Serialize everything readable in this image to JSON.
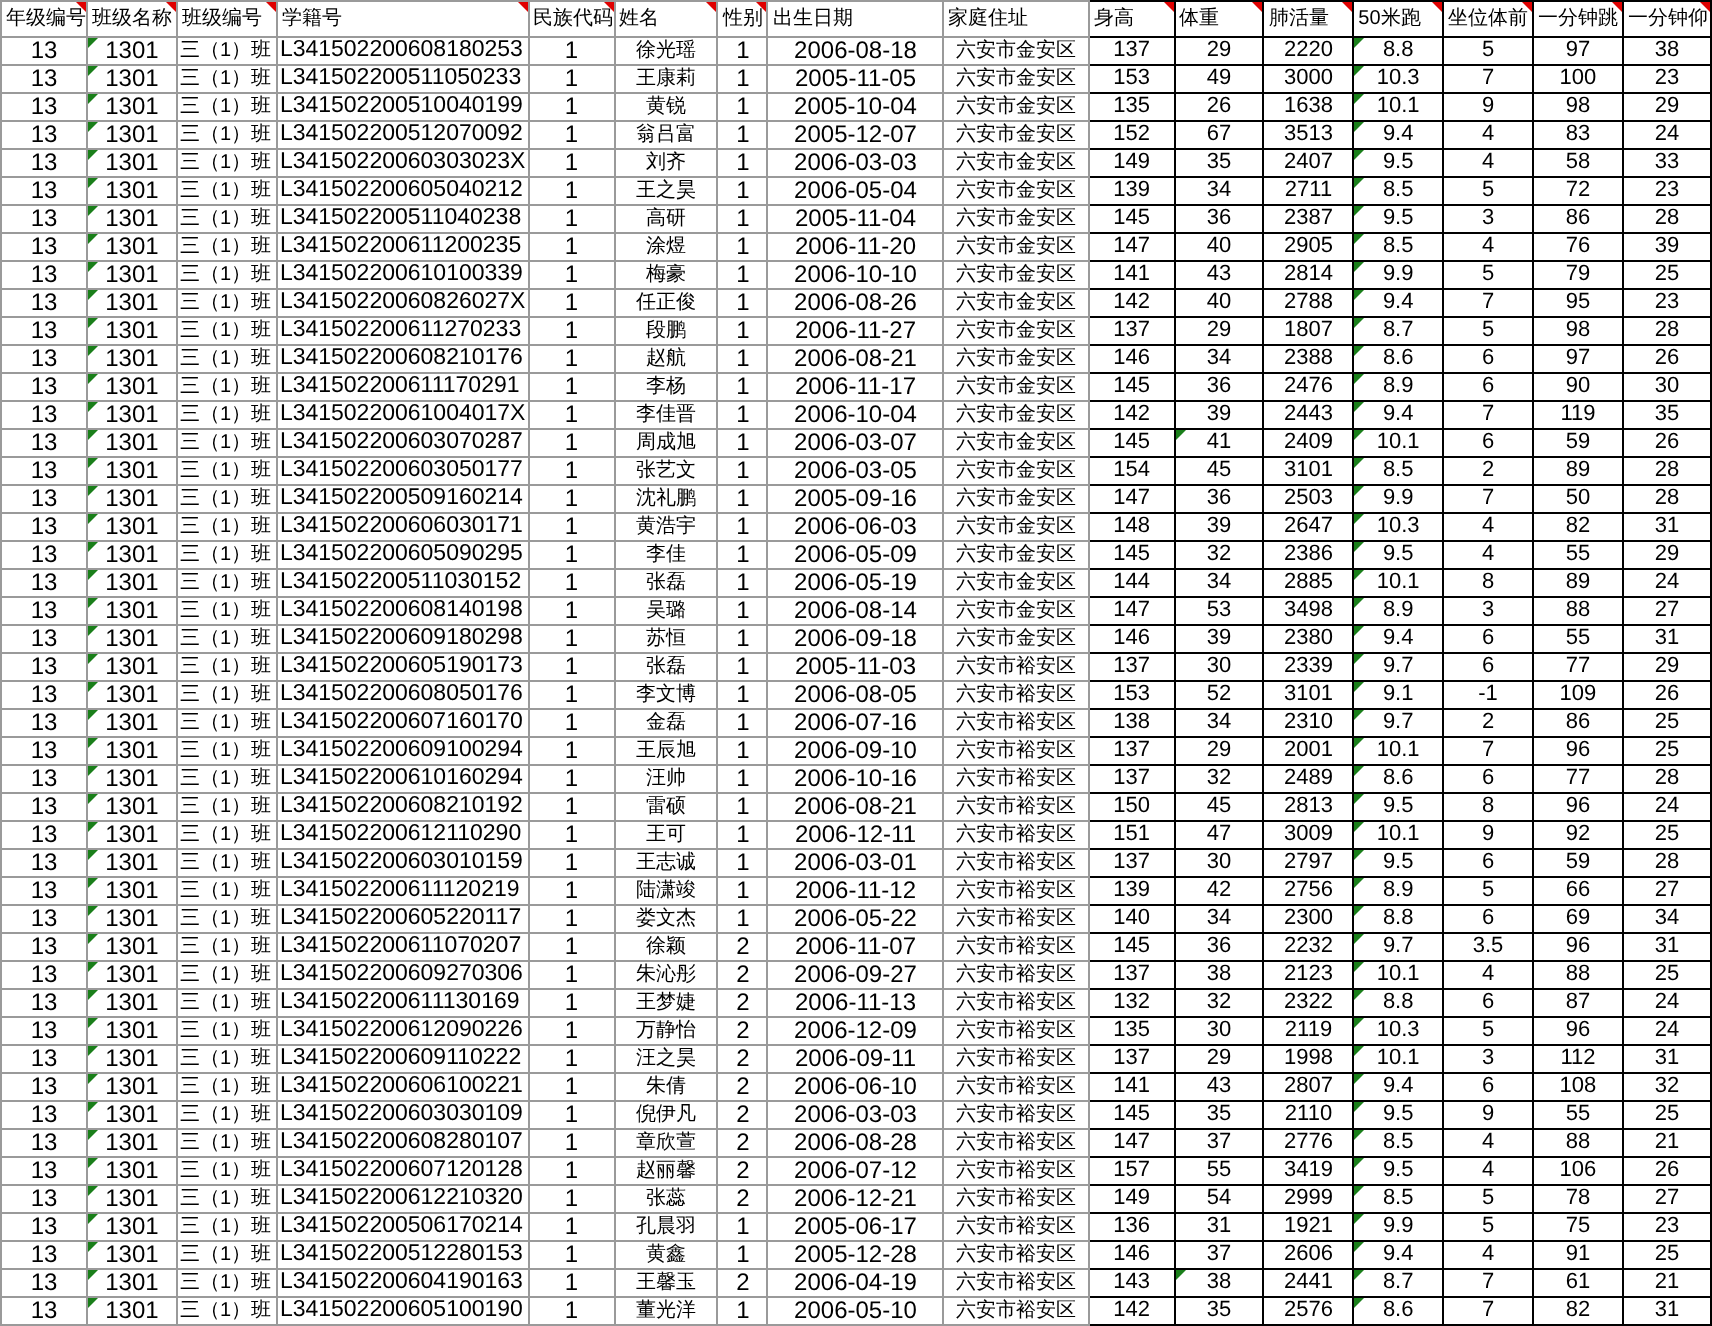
{
  "columns": [
    {
      "label": "年级编号",
      "comment": true,
      "flagged": false
    },
    {
      "label": "班级名称",
      "comment": true,
      "flagged": true
    },
    {
      "label": "班级编号",
      "comment": true,
      "flagged": false
    },
    {
      "label": "学籍号",
      "comment": true,
      "flagged": false
    },
    {
      "label": "民族代码",
      "comment": true,
      "flagged": false
    },
    {
      "label": "姓名",
      "comment": true,
      "flagged": false
    },
    {
      "label": "性别",
      "comment": true,
      "flagged": false
    },
    {
      "label": "出生日期",
      "comment": false,
      "flagged": false
    },
    {
      "label": "家庭住址",
      "comment": false,
      "flagged": false
    },
    {
      "label": "身高",
      "comment": true,
      "flagged": false
    },
    {
      "label": "体重",
      "comment": true,
      "flagged": false
    },
    {
      "label": "肺活量",
      "comment": true,
      "flagged": false
    },
    {
      "label": "50米跑",
      "comment": true,
      "flagged": true
    },
    {
      "label": "坐位体前",
      "comment": true,
      "flagged": false
    },
    {
      "label": "一分钟跳",
      "comment": true,
      "flagged": false
    },
    {
      "label": "一分钟仰",
      "comment": true,
      "flagged": false
    }
  ],
  "rows": [
    {
      "cells": [
        "13",
        "1301",
        "三（1）班",
        "L341502200608180253",
        "1",
        "徐光瑶",
        "1",
        "2006-08-18",
        "六安市金安区",
        "137",
        "29",
        "2220",
        "8.8",
        "5",
        "97",
        "38"
      ],
      "weight_flagged": false
    },
    {
      "cells": [
        "13",
        "1301",
        "三（1）班",
        "L341502200511050233",
        "1",
        "王康莉",
        "1",
        "2005-11-05",
        "六安市金安区",
        "153",
        "49",
        "3000",
        "10.3",
        "7",
        "100",
        "23"
      ],
      "weight_flagged": false
    },
    {
      "cells": [
        "13",
        "1301",
        "三（1）班",
        "L341502200510040199",
        "1",
        "黄锐",
        "1",
        "2005-10-04",
        "六安市金安区",
        "135",
        "26",
        "1638",
        "10.1",
        "9",
        "98",
        "29"
      ],
      "weight_flagged": false
    },
    {
      "cells": [
        "13",
        "1301",
        "三（1）班",
        "L341502200512070092",
        "1",
        "翁吕富",
        "1",
        "2005-12-07",
        "六安市金安区",
        "152",
        "67",
        "3513",
        "9.4",
        "4",
        "83",
        "24"
      ],
      "weight_flagged": false
    },
    {
      "cells": [
        "13",
        "1301",
        "三（1）班",
        "L34150220060303023X",
        "1",
        "刘齐",
        "1",
        "2006-03-03",
        "六安市金安区",
        "149",
        "35",
        "2407",
        "9.5",
        "4",
        "58",
        "33"
      ],
      "weight_flagged": false
    },
    {
      "cells": [
        "13",
        "1301",
        "三（1）班",
        "L341502200605040212",
        "1",
        "王之昊",
        "1",
        "2006-05-04",
        "六安市金安区",
        "139",
        "34",
        "2711",
        "8.5",
        "5",
        "72",
        "23"
      ],
      "weight_flagged": false
    },
    {
      "cells": [
        "13",
        "1301",
        "三（1）班",
        "L341502200511040238",
        "1",
        "高研",
        "1",
        "2005-11-04",
        "六安市金安区",
        "145",
        "36",
        "2387",
        "9.5",
        "3",
        "86",
        "28"
      ],
      "weight_flagged": false
    },
    {
      "cells": [
        "13",
        "1301",
        "三（1）班",
        "L341502200611200235",
        "1",
        "涂煜",
        "1",
        "2006-11-20",
        "六安市金安区",
        "147",
        "40",
        "2905",
        "8.5",
        "4",
        "76",
        "39"
      ],
      "weight_flagged": false
    },
    {
      "cells": [
        "13",
        "1301",
        "三（1）班",
        "L341502200610100339",
        "1",
        "梅豪",
        "1",
        "2006-10-10",
        "六安市金安区",
        "141",
        "43",
        "2814",
        "9.9",
        "5",
        "79",
        "25"
      ],
      "weight_flagged": false
    },
    {
      "cells": [
        "13",
        "1301",
        "三（1）班",
        "L34150220060826027X",
        "1",
        "任正俊",
        "1",
        "2006-08-26",
        "六安市金安区",
        "142",
        "40",
        "2788",
        "9.4",
        "7",
        "95",
        "23"
      ],
      "weight_flagged": false
    },
    {
      "cells": [
        "13",
        "1301",
        "三（1）班",
        "L341502200611270233",
        "1",
        "段鹏",
        "1",
        "2006-11-27",
        "六安市金安区",
        "137",
        "29",
        "1807",
        "8.7",
        "5",
        "98",
        "28"
      ],
      "weight_flagged": false
    },
    {
      "cells": [
        "13",
        "1301",
        "三（1）班",
        "L341502200608210176",
        "1",
        "赵航",
        "1",
        "2006-08-21",
        "六安市金安区",
        "146",
        "34",
        "2388",
        "8.6",
        "6",
        "97",
        "26"
      ],
      "weight_flagged": false
    },
    {
      "cells": [
        "13",
        "1301",
        "三（1）班",
        "L341502200611170291",
        "1",
        "李杨",
        "1",
        "2006-11-17",
        "六安市金安区",
        "145",
        "36",
        "2476",
        "8.9",
        "6",
        "90",
        "30"
      ],
      "weight_flagged": false
    },
    {
      "cells": [
        "13",
        "1301",
        "三（1）班",
        "L34150220061004017X",
        "1",
        "李佳晋",
        "1",
        "2006-10-04",
        "六安市金安区",
        "142",
        "39",
        "2443",
        "9.4",
        "7",
        "119",
        "35"
      ],
      "weight_flagged": false
    },
    {
      "cells": [
        "13",
        "1301",
        "三（1）班",
        "L341502200603070287",
        "1",
        "周成旭",
        "1",
        "2006-03-07",
        "六安市金安区",
        "145",
        "41",
        "2409",
        "10.1",
        "6",
        "59",
        "26"
      ],
      "weight_flagged": true
    },
    {
      "cells": [
        "13",
        "1301",
        "三（1）班",
        "L341502200603050177",
        "1",
        "张艺文",
        "1",
        "2006-03-05",
        "六安市金安区",
        "154",
        "45",
        "3101",
        "8.5",
        "2",
        "89",
        "28"
      ],
      "weight_flagged": false
    },
    {
      "cells": [
        "13",
        "1301",
        "三（1）班",
        "L341502200509160214",
        "1",
        "沈礼鹏",
        "1",
        "2005-09-16",
        "六安市金安区",
        "147",
        "36",
        "2503",
        "9.9",
        "7",
        "50",
        "28"
      ],
      "weight_flagged": false
    },
    {
      "cells": [
        "13",
        "1301",
        "三（1）班",
        "L341502200606030171",
        "1",
        "黄浩宇",
        "1",
        "2006-06-03",
        "六安市金安区",
        "148",
        "39",
        "2647",
        "10.3",
        "4",
        "82",
        "31"
      ],
      "weight_flagged": false
    },
    {
      "cells": [
        "13",
        "1301",
        "三（1）班",
        "L341502200605090295",
        "1",
        "李佳",
        "1",
        "2006-05-09",
        "六安市金安区",
        "145",
        "32",
        "2386",
        "9.5",
        "4",
        "55",
        "29"
      ],
      "weight_flagged": false
    },
    {
      "cells": [
        "13",
        "1301",
        "三（1）班",
        "L341502200511030152",
        "1",
        "张磊",
        "1",
        "2006-05-19",
        "六安市金安区",
        "144",
        "34",
        "2885",
        "10.1",
        "8",
        "89",
        "24"
      ],
      "weight_flagged": false
    },
    {
      "cells": [
        "13",
        "1301",
        "三（1）班",
        "L341502200608140198",
        "1",
        "吴璐",
        "1",
        "2006-08-14",
        "六安市金安区",
        "147",
        "53",
        "3498",
        "8.9",
        "3",
        "88",
        "27"
      ],
      "weight_flagged": false
    },
    {
      "cells": [
        "13",
        "1301",
        "三（1）班",
        "L341502200609180298",
        "1",
        "苏恒",
        "1",
        "2006-09-18",
        "六安市金安区",
        "146",
        "39",
        "2380",
        "9.4",
        "6",
        "55",
        "31"
      ],
      "weight_flagged": false
    },
    {
      "cells": [
        "13",
        "1301",
        "三（1）班",
        "L341502200605190173",
        "1",
        "张磊",
        "1",
        "2005-11-03",
        "六安市裕安区",
        "137",
        "30",
        "2339",
        "9.7",
        "6",
        "77",
        "29"
      ],
      "weight_flagged": false
    },
    {
      "cells": [
        "13",
        "1301",
        "三（1）班",
        "L341502200608050176",
        "1",
        "李文博",
        "1",
        "2006-08-05",
        "六安市裕安区",
        "153",
        "52",
        "3101",
        "9.1",
        "-1",
        "109",
        "26"
      ],
      "weight_flagged": false
    },
    {
      "cells": [
        "13",
        "1301",
        "三（1）班",
        "L341502200607160170",
        "1",
        "金磊",
        "1",
        "2006-07-16",
        "六安市裕安区",
        "138",
        "34",
        "2310",
        "9.7",
        "2",
        "86",
        "25"
      ],
      "weight_flagged": false
    },
    {
      "cells": [
        "13",
        "1301",
        "三（1）班",
        "L341502200609100294",
        "1",
        "王辰旭",
        "1",
        "2006-09-10",
        "六安市裕安区",
        "137",
        "29",
        "2001",
        "10.1",
        "7",
        "96",
        "25"
      ],
      "weight_flagged": false
    },
    {
      "cells": [
        "13",
        "1301",
        "三（1）班",
        "L341502200610160294",
        "1",
        "汪帅",
        "1",
        "2006-10-16",
        "六安市裕安区",
        "137",
        "32",
        "2489",
        "8.6",
        "6",
        "77",
        "28"
      ],
      "weight_flagged": false
    },
    {
      "cells": [
        "13",
        "1301",
        "三（1）班",
        "L341502200608210192",
        "1",
        "雷硕",
        "1",
        "2006-08-21",
        "六安市裕安区",
        "150",
        "45",
        "2813",
        "9.5",
        "8",
        "96",
        "24"
      ],
      "weight_flagged": false
    },
    {
      "cells": [
        "13",
        "1301",
        "三（1）班",
        "L341502200612110290",
        "1",
        "王可",
        "1",
        "2006-12-11",
        "六安市裕安区",
        "151",
        "47",
        "3009",
        "10.1",
        "9",
        "92",
        "25"
      ],
      "weight_flagged": false
    },
    {
      "cells": [
        "13",
        "1301",
        "三（1）班",
        "L341502200603010159",
        "1",
        "王志诚",
        "1",
        "2006-03-01",
        "六安市裕安区",
        "137",
        "30",
        "2797",
        "9.5",
        "6",
        "59",
        "28"
      ],
      "weight_flagged": false
    },
    {
      "cells": [
        "13",
        "1301",
        "三（1）班",
        "L341502200611120219",
        "1",
        "陆潇竣",
        "1",
        "2006-11-12",
        "六安市裕安区",
        "139",
        "42",
        "2756",
        "8.9",
        "5",
        "66",
        "27"
      ],
      "weight_flagged": false
    },
    {
      "cells": [
        "13",
        "1301",
        "三（1）班",
        "L341502200605220117",
        "1",
        "娄文杰",
        "1",
        "2006-05-22",
        "六安市裕安区",
        "140",
        "34",
        "2300",
        "8.8",
        "6",
        "69",
        "34"
      ],
      "weight_flagged": false
    },
    {
      "cells": [
        "13",
        "1301",
        "三（1）班",
        "L341502200611070207",
        "1",
        "徐颖",
        "2",
        "2006-11-07",
        "六安市裕安区",
        "145",
        "36",
        "2232",
        "9.7",
        "3.5",
        "96",
        "31"
      ],
      "weight_flagged": false
    },
    {
      "cells": [
        "13",
        "1301",
        "三（1）班",
        "L341502200609270306",
        "1",
        "朱沁彤",
        "2",
        "2006-09-27",
        "六安市裕安区",
        "137",
        "38",
        "2123",
        "10.1",
        "4",
        "88",
        "25"
      ],
      "weight_flagged": false
    },
    {
      "cells": [
        "13",
        "1301",
        "三（1）班",
        "L341502200611130169",
        "1",
        "王梦婕",
        "2",
        "2006-11-13",
        "六安市裕安区",
        "132",
        "32",
        "2322",
        "8.8",
        "6",
        "87",
        "24"
      ],
      "weight_flagged": false
    },
    {
      "cells": [
        "13",
        "1301",
        "三（1）班",
        "L341502200612090226",
        "1",
        "万静怡",
        "2",
        "2006-12-09",
        "六安市裕安区",
        "135",
        "30",
        "2119",
        "10.3",
        "5",
        "96",
        "24"
      ],
      "weight_flagged": false
    },
    {
      "cells": [
        "13",
        "1301",
        "三（1）班",
        "L341502200609110222",
        "1",
        "汪之昊",
        "2",
        "2006-09-11",
        "六安市裕安区",
        "137",
        "29",
        "1998",
        "10.1",
        "3",
        "112",
        "31"
      ],
      "weight_flagged": false
    },
    {
      "cells": [
        "13",
        "1301",
        "三（1）班",
        "L341502200606100221",
        "1",
        "朱倩",
        "2",
        "2006-06-10",
        "六安市裕安区",
        "141",
        "43",
        "2807",
        "9.4",
        "6",
        "108",
        "32"
      ],
      "weight_flagged": false
    },
    {
      "cells": [
        "13",
        "1301",
        "三（1）班",
        "L341502200603030109",
        "1",
        "倪伊凡",
        "2",
        "2006-03-03",
        "六安市裕安区",
        "145",
        "35",
        "2110",
        "9.5",
        "9",
        "55",
        "25"
      ],
      "weight_flagged": false
    },
    {
      "cells": [
        "13",
        "1301",
        "三（1）班",
        "L341502200608280107",
        "1",
        "章欣萱",
        "2",
        "2006-08-28",
        "六安市裕安区",
        "147",
        "37",
        "2776",
        "8.5",
        "4",
        "88",
        "21"
      ],
      "weight_flagged": false
    },
    {
      "cells": [
        "13",
        "1301",
        "三（1）班",
        "L341502200607120128",
        "1",
        "赵丽馨",
        "2",
        "2006-07-12",
        "六安市裕安区",
        "157",
        "55",
        "3419",
        "9.5",
        "4",
        "106",
        "26"
      ],
      "weight_flagged": false
    },
    {
      "cells": [
        "13",
        "1301",
        "三（1）班",
        "L341502200612210320",
        "1",
        "张蕊",
        "2",
        "2006-12-21",
        "六安市裕安区",
        "149",
        "54",
        "2999",
        "8.5",
        "5",
        "78",
        "27"
      ],
      "weight_flagged": false
    },
    {
      "cells": [
        "13",
        "1301",
        "三（1）班",
        "L341502200506170214",
        "1",
        "孔晨羽",
        "1",
        "2005-06-17",
        "六安市裕安区",
        "136",
        "31",
        "1921",
        "9.9",
        "5",
        "75",
        "23"
      ],
      "weight_flagged": false
    },
    {
      "cells": [
        "13",
        "1301",
        "三（1）班",
        "L341502200512280153",
        "1",
        "黄鑫",
        "1",
        "2005-12-28",
        "六安市裕安区",
        "146",
        "37",
        "2606",
        "9.4",
        "4",
        "91",
        "25"
      ],
      "weight_flagged": false
    },
    {
      "cells": [
        "13",
        "1301",
        "三（1）班",
        "L341502200604190163",
        "1",
        "王馨玉",
        "2",
        "2006-04-19",
        "六安市裕安区",
        "143",
        "38",
        "2441",
        "8.7",
        "7",
        "61",
        "21"
      ],
      "weight_flagged": true
    },
    {
      "cells": [
        "13",
        "1301",
        "三（1）班",
        "L341502200605100190",
        "1",
        "董光洋",
        "1",
        "2006-05-10",
        "六安市裕安区",
        "142",
        "35",
        "2576",
        "8.6",
        "7",
        "82",
        "31"
      ],
      "weight_flagged": false
    }
  ]
}
